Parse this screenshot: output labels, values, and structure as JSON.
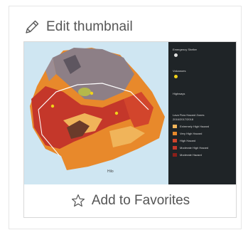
{
  "edit": {
    "label": "Edit thumbnail",
    "icon": "pencil-icon"
  },
  "favorites": {
    "label": "Add to Favorites",
    "icon": "star-outline-icon"
  },
  "map": {
    "legend_items": [
      "Emergency Shelter",
      "Volcanoes",
      "Highways",
      "Lava Flow Hazard Zones"
    ],
    "legend_sub": "2016/2017/2018",
    "hazard_zones": [
      "Extremely High Hazard",
      "Very High Hazard",
      "High Hazard",
      "Moderate High Hazard",
      "Moderate Hazard"
    ],
    "ocean_label": "Hilo",
    "colors": {
      "ocean": "#cfe6f2",
      "zone_gray": "#8d7f86",
      "zone_red": "#c4372a",
      "zone_orange": "#e8892b",
      "zone_light": "#f0b45a",
      "legend_bg": "#1f2427"
    }
  }
}
